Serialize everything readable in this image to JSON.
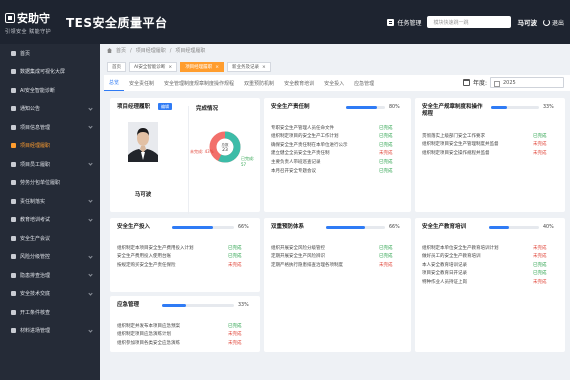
{
  "header": {
    "logo_text": "安助守",
    "logo_slogan": "引领安全 赋能守护",
    "system_title": "TES安全质量平台",
    "task_label": "任务管理",
    "search_placeholder": "模块快速跳一跳",
    "user_name": "马可波",
    "logout_label": "退出"
  },
  "sidebar": {
    "items": [
      {
        "label": "首页",
        "icon": "home-icon",
        "has_arrow": false
      },
      {
        "label": "数据集成可视化大屏",
        "icon": "monitor-icon",
        "has_arrow": false
      },
      {
        "label": "AI安全智能诊断",
        "icon": "ai-icon",
        "has_arrow": false
      },
      {
        "label": "通知公告",
        "icon": "bell-icon",
        "has_arrow": true
      },
      {
        "label": "项目信息管理",
        "icon": "folder-icon",
        "has_arrow": true
      },
      {
        "label": "项目经理履职",
        "icon": "user-icon",
        "has_arrow": false,
        "active": true
      },
      {
        "label": "项目员工履职",
        "icon": "users-icon",
        "has_arrow": true
      },
      {
        "label": "劳务分包单位履职",
        "icon": "building-icon",
        "has_arrow": false
      },
      {
        "label": "责任制落实",
        "icon": "doc-icon",
        "has_arrow": true
      },
      {
        "label": "教育培训考试",
        "icon": "book-icon",
        "has_arrow": true
      },
      {
        "label": "安全生产会议",
        "icon": "meeting-icon",
        "has_arrow": false
      },
      {
        "label": "风险分级管控",
        "icon": "shield-icon",
        "has_arrow": true
      },
      {
        "label": "隐患排查治理",
        "icon": "search-icon",
        "has_arrow": true
      },
      {
        "label": "安全技术交底",
        "icon": "tech-icon",
        "has_arrow": true
      },
      {
        "label": "开工条件核查",
        "icon": "check-icon",
        "has_arrow": false
      },
      {
        "label": "材料进场管理",
        "icon": "box-icon",
        "has_arrow": true
      }
    ]
  },
  "breadcrumb": [
    "首页",
    "项目经理履职",
    "项目经理履职"
  ],
  "tags": [
    {
      "label": "首页",
      "closable": false,
      "active": false
    },
    {
      "label": "AI安全智能诊断",
      "closable": true,
      "active": false
    },
    {
      "label": "项目经理履职",
      "closable": true,
      "active": true
    },
    {
      "label": "新业务及记录",
      "closable": true,
      "active": false
    }
  ],
  "module_tabs": [
    "总览",
    "安全责任制",
    "安全管理制度规章制度操作规程",
    "双重预防机制",
    "安全教育培训",
    "安全投入",
    "应急管理"
  ],
  "year": {
    "label": "年度:",
    "value": "2025"
  },
  "profile": {
    "card_title": "项目经理履职",
    "edit_label": "编辑",
    "name": "马可波",
    "donut_title": "完成情况",
    "total_label": "总数",
    "total": 23,
    "done_label": "已完成: 57",
    "todo_label": "未完成: 43%",
    "done_pct": 57,
    "todo_pct": 43,
    "colors": {
      "done": "#3dbca8",
      "todo": "#f2706b"
    }
  },
  "cards": [
    {
      "id": "responsibility",
      "title": "安全生产责任制",
      "percent_text": "80%",
      "percent": 80,
      "rows": [
        {
          "text": "专职安全生产管理人员任命文件",
          "status": "已完成"
        },
        {
          "text": "组织制定项目的安全生产工作计划",
          "status": "已完成"
        },
        {
          "text": "确保安全生产责任制在本单位进行公示",
          "status": "已完成"
        },
        {
          "text": "建立健全全员安全生产责任制",
          "status": "未完成"
        },
        {
          "text": "主要负责人带班巡查记录",
          "status": "已完成"
        },
        {
          "text": "本月召开安全专题会议",
          "status": "已完成"
        }
      ]
    },
    {
      "id": "regulations",
      "title": "安全生产规章制度和操作规程",
      "percent_text": "33%",
      "percent": 33,
      "rows": [
        {
          "text": "贯彻落实上级部门安全工作要求",
          "status": "已完成"
        },
        {
          "text": "组织制定项目安全生产管理制度并监督",
          "status": "未完成"
        },
        {
          "text": "组织制定项目安全操作规程并监督",
          "status": "未完成"
        }
      ]
    },
    {
      "id": "investment",
      "title": "安全生产投入",
      "percent_text": "66%",
      "percent": 66,
      "rows": [
        {
          "text": "组织制定本项目安全生产费用投入计划",
          "status": "已完成"
        },
        {
          "text": "安全生产费用投入使用台账",
          "status": "已完成"
        },
        {
          "text": "按规定购买安全生产责任保险",
          "status": "未完成"
        }
      ]
    },
    {
      "id": "prevention",
      "title": "双重预防体系",
      "percent_text": "66%",
      "percent": 66,
      "rows": [
        {
          "text": "组织开展安全风险分级管控",
          "status": "已完成"
        },
        {
          "text": "定期开展安全生产风险辨识",
          "status": "已完成"
        },
        {
          "text": "定期严格执行隐患排查治理各项制度",
          "status": "未完成"
        }
      ]
    },
    {
      "id": "training",
      "title": "安全生产教育培训",
      "percent_text": "40%",
      "percent": 40,
      "rows": [
        {
          "text": "组织制定本单位安全生产教育培训计划",
          "status": "未完成"
        },
        {
          "text": "做好员工的安全生产教育培训",
          "status": "未完成"
        },
        {
          "text": "本人安全教育培训记录",
          "status": "已完成"
        },
        {
          "text": "项目安全教育日开记录",
          "status": "已完成"
        },
        {
          "text": "特种作业人员持证上岗",
          "status": "未完成"
        }
      ]
    },
    {
      "id": "emergency",
      "title": "应急管理",
      "percent_text": "33%",
      "percent": 33,
      "rows": [
        {
          "text": "组织制定并发布本项目应急预案",
          "status": "已完成"
        },
        {
          "text": "组织制定项目应急演练计划",
          "status": "未完成"
        },
        {
          "text": "组织参加项目各类安全应急演练",
          "status": "未完成"
        }
      ]
    }
  ]
}
